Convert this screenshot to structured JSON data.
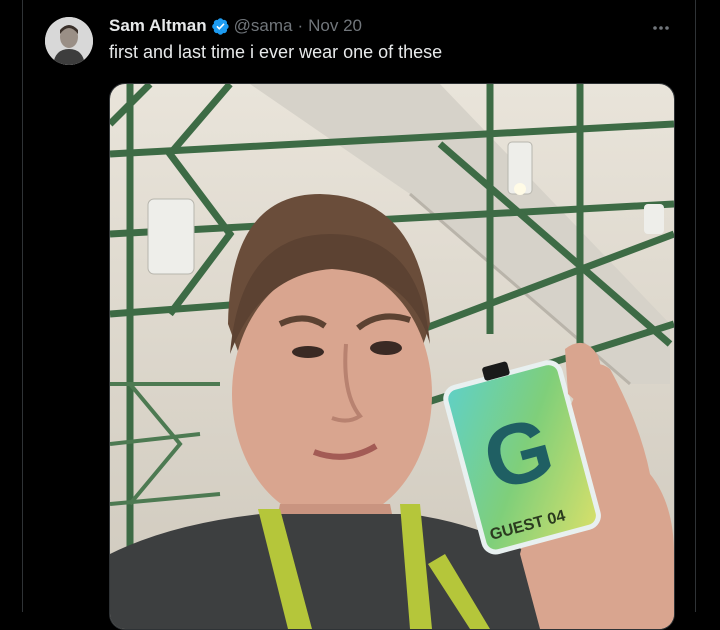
{
  "tweet": {
    "author_name": "Sam Altman",
    "handle": "@sama",
    "separator": "·",
    "date": "Nov 20",
    "text": "first and last time i ever wear one of these",
    "more_icon": "more-horizontal-icon",
    "verified_icon": "verified-badge-icon"
  },
  "media": {
    "badge_letter": "G",
    "badge_text": "GUEST 04"
  },
  "colors": {
    "background": "#000000",
    "text_primary": "#e7e9ea",
    "text_secondary": "#71767b",
    "verified": "#1d9bf0",
    "border": "#2f3336"
  }
}
